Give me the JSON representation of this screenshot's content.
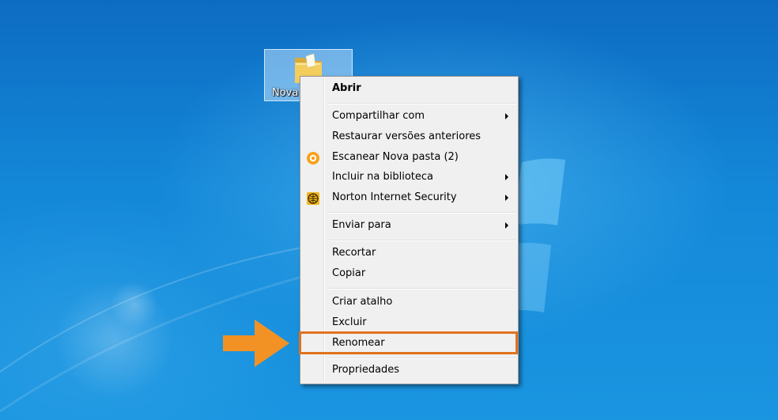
{
  "desktop": {
    "icon": {
      "name": "folder-icon",
      "label": "Nova"
    }
  },
  "menu": {
    "open_label": "Abrir",
    "share_label": "Compartilhar com",
    "restore_label": "Restaurar versões anteriores",
    "scan_label": "Escanear Nova pasta (2)",
    "library_label": "Incluir na biblioteca",
    "norton_label": "Norton Internet Security",
    "send_label": "Enviar para",
    "cut_label": "Recortar",
    "copy_label": "Copiar",
    "shortcut_label": "Criar atalho",
    "delete_label": "Excluir",
    "rename_label": "Renomear",
    "properties_label": "Propriedades",
    "icons": {
      "scan": "avast-scan-icon",
      "norton": "norton-globe-icon"
    }
  },
  "annotation": {
    "highlight_color": "#e0721d",
    "arrow_color": "#f39224"
  }
}
